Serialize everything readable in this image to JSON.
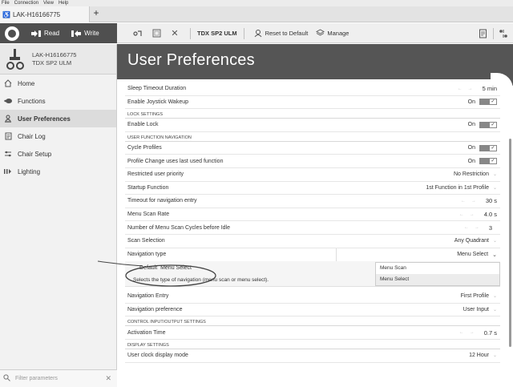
{
  "menubar": [
    "File",
    "Connection",
    "View",
    "Help"
  ],
  "tab": {
    "label": "LAK-H16166775",
    "add": "+"
  },
  "toolbar": {
    "read": "Read",
    "write": "Write",
    "device_model": "TDX SP2 ULM",
    "reset": "Reset to Default",
    "manage": "Manage"
  },
  "sidebar": {
    "device_id": "LAK-H16166775",
    "device_model": "TDX SP2 ULM",
    "items": [
      {
        "label": "Home",
        "icon": "home-icon"
      },
      {
        "label": "Functions",
        "icon": "functions-icon"
      },
      {
        "label": "User Preferences",
        "icon": "user-icon"
      },
      {
        "label": "Chair Log",
        "icon": "log-icon"
      },
      {
        "label": "Chair Setup",
        "icon": "setup-icon"
      },
      {
        "label": "Lighting",
        "icon": "lighting-icon"
      }
    ],
    "filter_placeholder": "Filter parameters"
  },
  "main": {
    "title": "User Preferences",
    "r_sleep": {
      "label": "Sleep Timeout Duration",
      "value": "5",
      "unit": "min"
    },
    "r_joystick": {
      "label": "Enable Joystick Wakeup",
      "value": "On"
    },
    "s_lock": "LOCK SETTINGS",
    "r_lock": {
      "label": "Enable Lock",
      "value": "On"
    },
    "s_nav": "USER FUNCTION NAVIGATION",
    "r_cycle": {
      "label": "Cycle Profiles",
      "value": "On"
    },
    "r_profile_change": {
      "label": "Profile Change uses last used function",
      "value": "On"
    },
    "r_restricted": {
      "label": "Restricted user priority",
      "value": "No Restriction"
    },
    "r_startup": {
      "label": "Startup Function",
      "value": "1st Function in 1st Profile"
    },
    "r_timeout_nav": {
      "label": "Timeout for navigation entry",
      "value": "30",
      "unit": "s"
    },
    "r_scan_rate": {
      "label": "Menu Scan Rate",
      "value": "4.0",
      "unit": "s"
    },
    "r_scan_cycles": {
      "label": "Number of Menu Scan Cycles before Idle",
      "value": "3"
    },
    "r_scan_sel": {
      "label": "Scan Selection",
      "value": "Any Quadrant"
    },
    "r_nav_type": {
      "label": "Navigation type",
      "value": "Menu Select"
    },
    "detail": {
      "default_label": "Default",
      "default_value": "Menu Select",
      "description": "Selects the type of navigation (menu scan or menu select).",
      "options": [
        "Menu Scan",
        "Menu Select"
      ]
    },
    "r_nav_entry": {
      "label": "Navigation Entry",
      "value": "First Profile"
    },
    "r_nav_pref": {
      "label": "Navigation preference",
      "value": "User Input"
    },
    "s_control": "CONTROL INPUT/OUTPUT SETTINGS",
    "r_activation": {
      "label": "Activation Time",
      "value": "0.7",
      "unit": "s"
    },
    "s_display": "DISPLAY SETTINGS",
    "r_clock": {
      "label": "User clock display mode",
      "value": "12 Hour"
    }
  }
}
